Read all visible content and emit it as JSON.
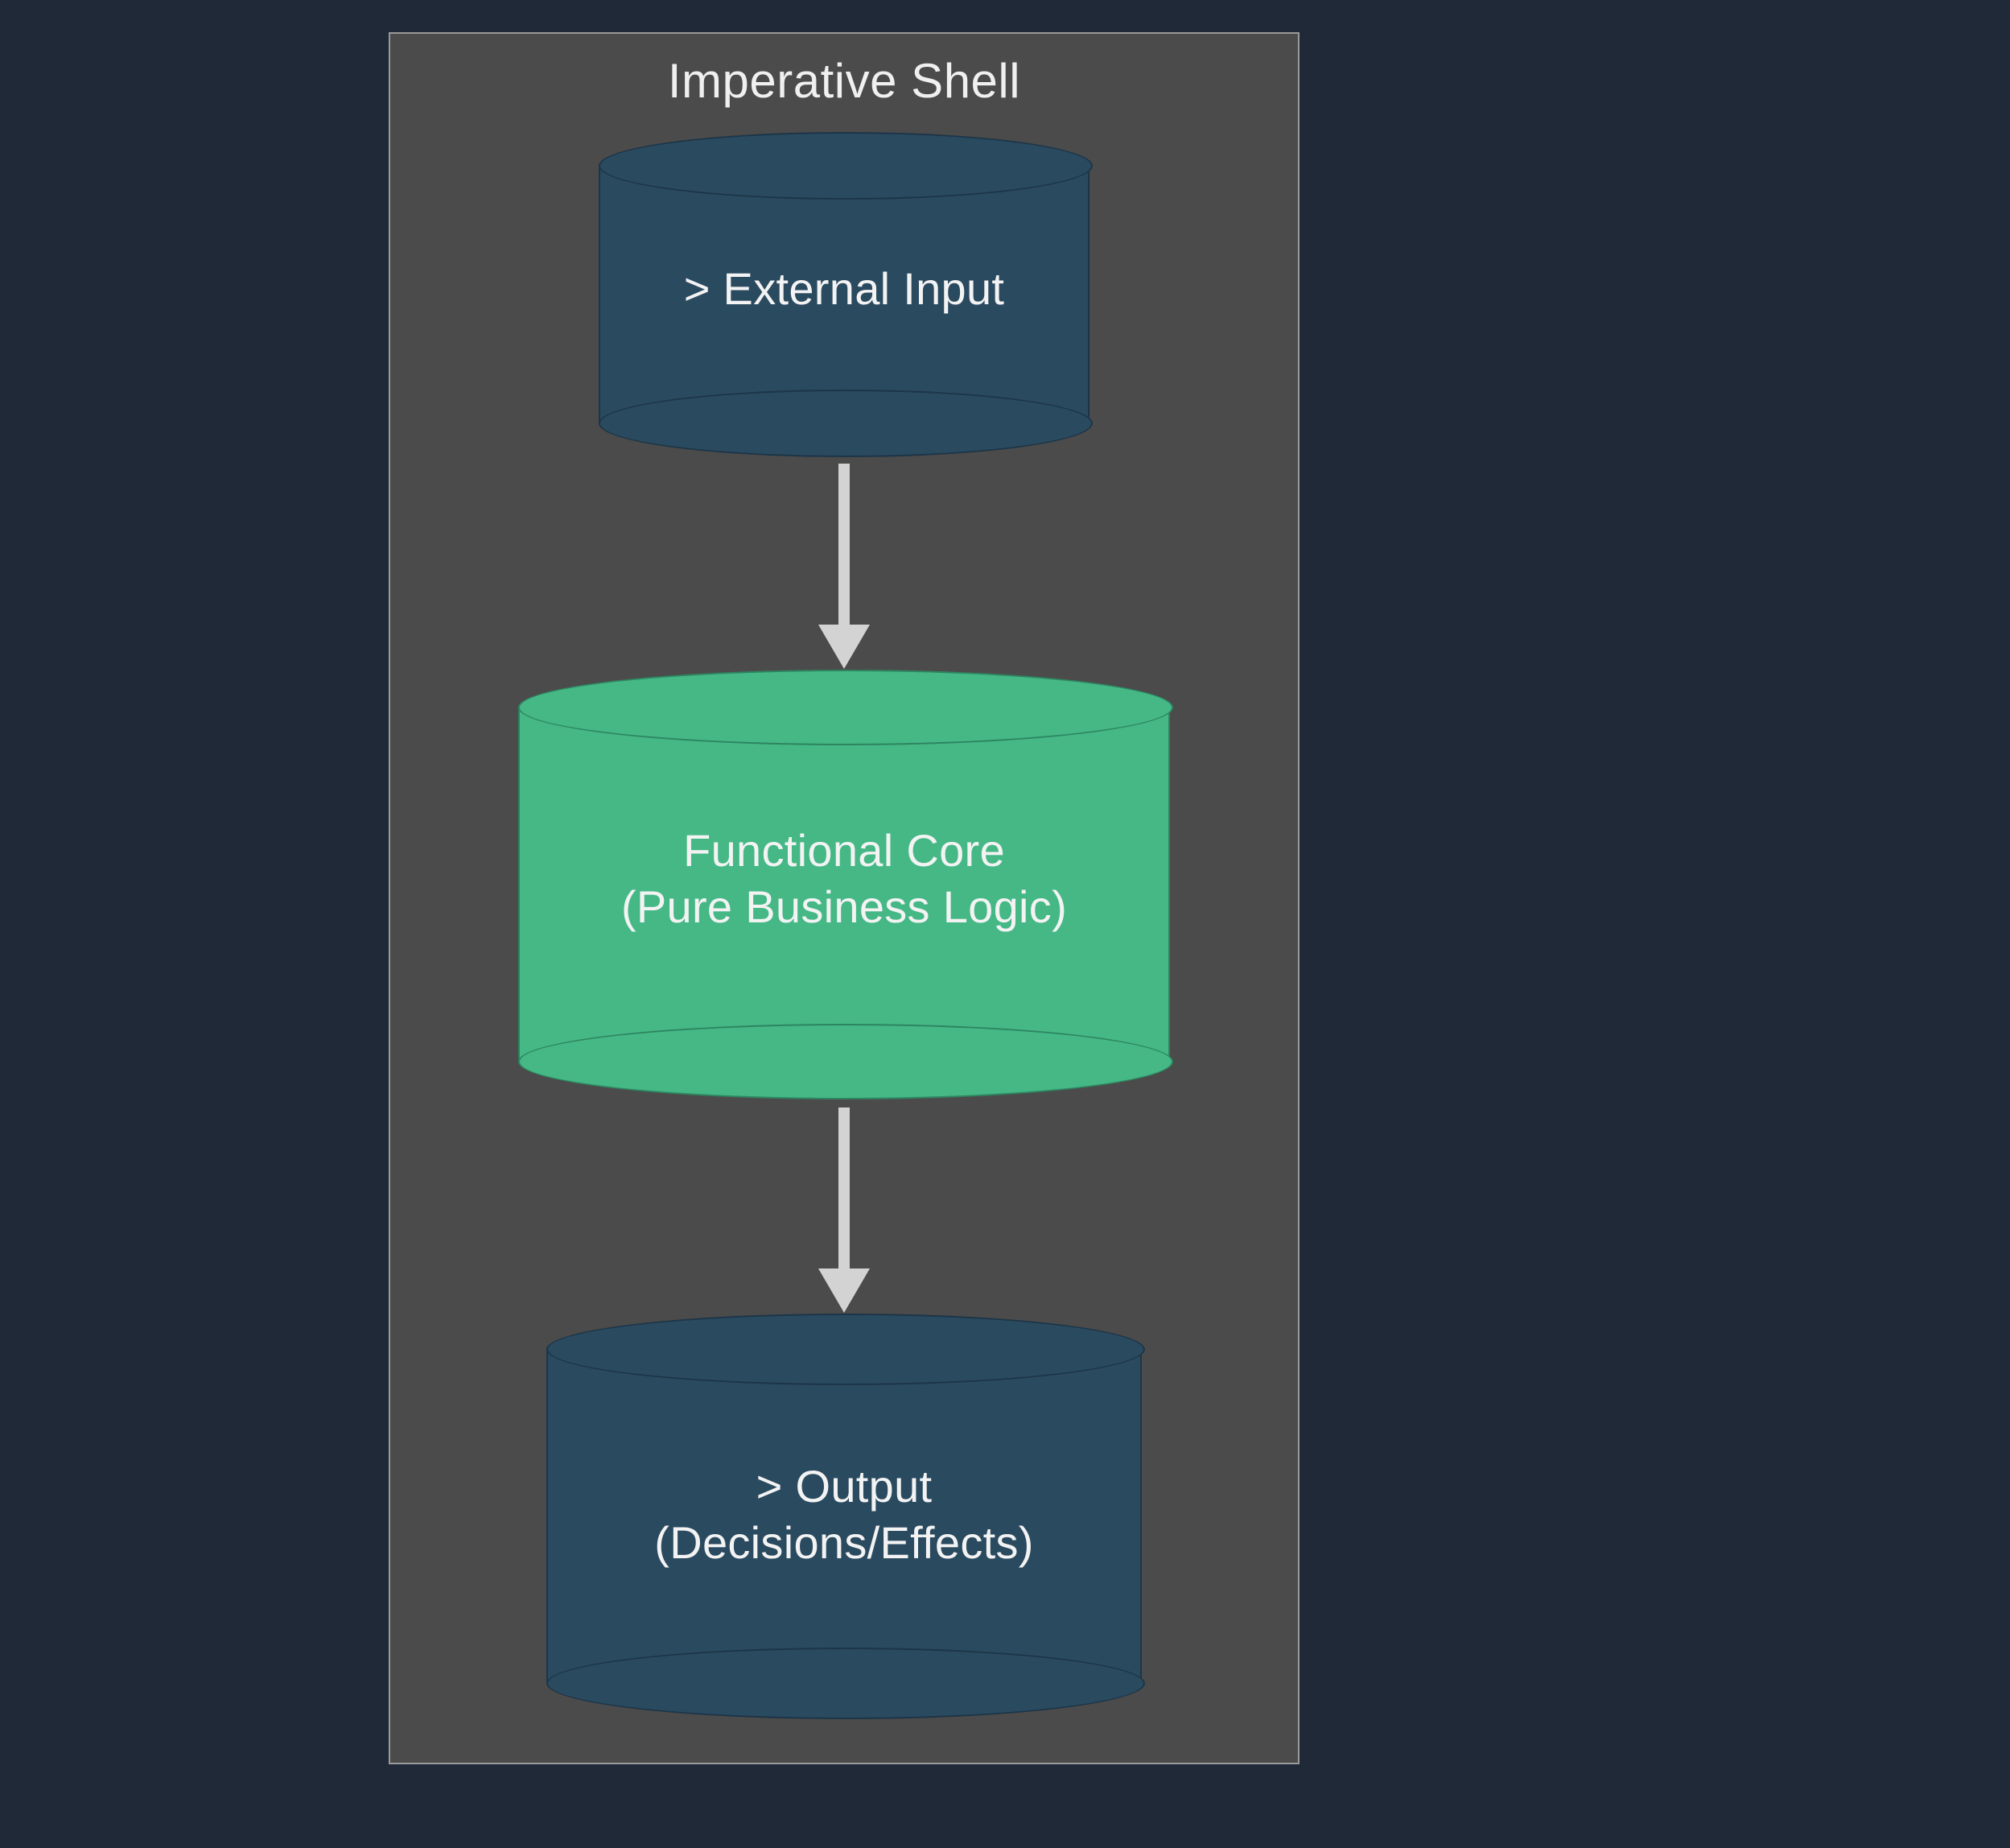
{
  "diagram": {
    "container": {
      "title": "Imperative Shell",
      "fill": "#4b4b4b",
      "stroke": "#9a9a9a"
    },
    "nodes": [
      {
        "id": "external-input",
        "shape": "cylinder",
        "label": "> External Input",
        "fill": "#2a4a60",
        "stroke": "#1d3547",
        "text_color": "#f3f3f3"
      },
      {
        "id": "functional-core",
        "shape": "cylinder",
        "label": "Functional Core\n(Pure Business Logic)",
        "fill": "#45b886",
        "stroke": "#2e8560",
        "text_color": "#f3f3f3"
      },
      {
        "id": "output",
        "shape": "cylinder",
        "label": "> Output\n(Decisions/Effects)",
        "fill": "#2a4a60",
        "stroke": "#1d3547",
        "text_color": "#f3f3f3"
      }
    ],
    "edges": [
      {
        "from": "external-input",
        "to": "functional-core",
        "style": "solid-arrow",
        "color": "#d3d3d3"
      },
      {
        "from": "functional-core",
        "to": "output",
        "style": "solid-arrow",
        "color": "#d3d3d3"
      }
    ],
    "background": "#1f2937"
  }
}
